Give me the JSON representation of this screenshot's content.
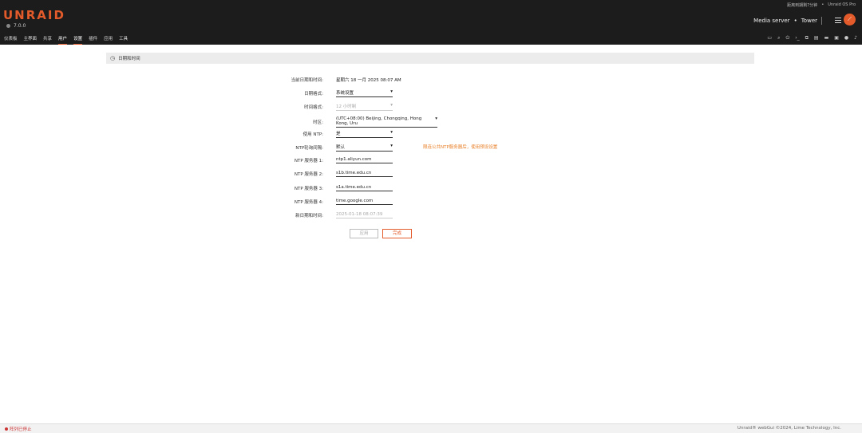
{
  "header": {
    "brand": "UNRAID",
    "version": "7.0.0",
    "top_right": [
      "距离到期剩7分钟",
      "•",
      "Unraid OS Pro"
    ],
    "server_desc": "Media server",
    "server_dot": "•",
    "server_name": "Tower"
  },
  "nav": [
    "仪表板",
    "主界面",
    "共享",
    "用户",
    "设置",
    "插件",
    "应用",
    "工具"
  ],
  "toolbar_icons": [
    "feedback-icon",
    "search-icon",
    "power-icon",
    "terminal-icon",
    "copy-icon",
    "log-icon",
    "monitor-icon",
    "info-icon",
    "help-icon",
    "bell-icon"
  ],
  "section": {
    "title": "日期和时间"
  },
  "form": {
    "current_label": "当前日期和时间:",
    "current_value": "星期六 18 一月 2025 08:07 AM",
    "date_format_label": "日期格式:",
    "date_format_value": "系统设置",
    "time_format_label": "时间格式:",
    "time_format_value": "12 小时制",
    "timezone_label": "时区:",
    "timezone_value": "(UTC+08:00) Beijing, Chongqing, Hong Kong, Uru",
    "use_ntp_label": "使用 NTP:",
    "use_ntp_value": "是",
    "ntp_interval_label": "NTP轮询间隔:",
    "ntp_interval_value": "默认",
    "ntp_hint": "限连公共NTP服务器后，使用预设设置",
    "ntp1_label": "NTP 服务器 1:",
    "ntp1_value": "ntp1.aliyun.com",
    "ntp2_label": "NTP 服务器 2:",
    "ntp2_value": "s1b.time.edu.cn",
    "ntp3_label": "NTP 服务器 3:",
    "ntp3_value": "s1a.time.edu.cn",
    "ntp4_label": "NTP 服务器 4:",
    "ntp4_value": "time.google.com",
    "new_dt_label": "新日期和时间:",
    "new_dt_value": "2025-01-18 08:07:39",
    "apply_label": "应用",
    "done_label": "完成"
  },
  "footer": {
    "status": "阵列已停止",
    "copyright": "Unraid® webGui ©2024, Lime Technology, Inc."
  },
  "colors": {
    "accent": "#e35b2b",
    "hint": "#e87e24",
    "header_bg": "#1c1c1c"
  }
}
